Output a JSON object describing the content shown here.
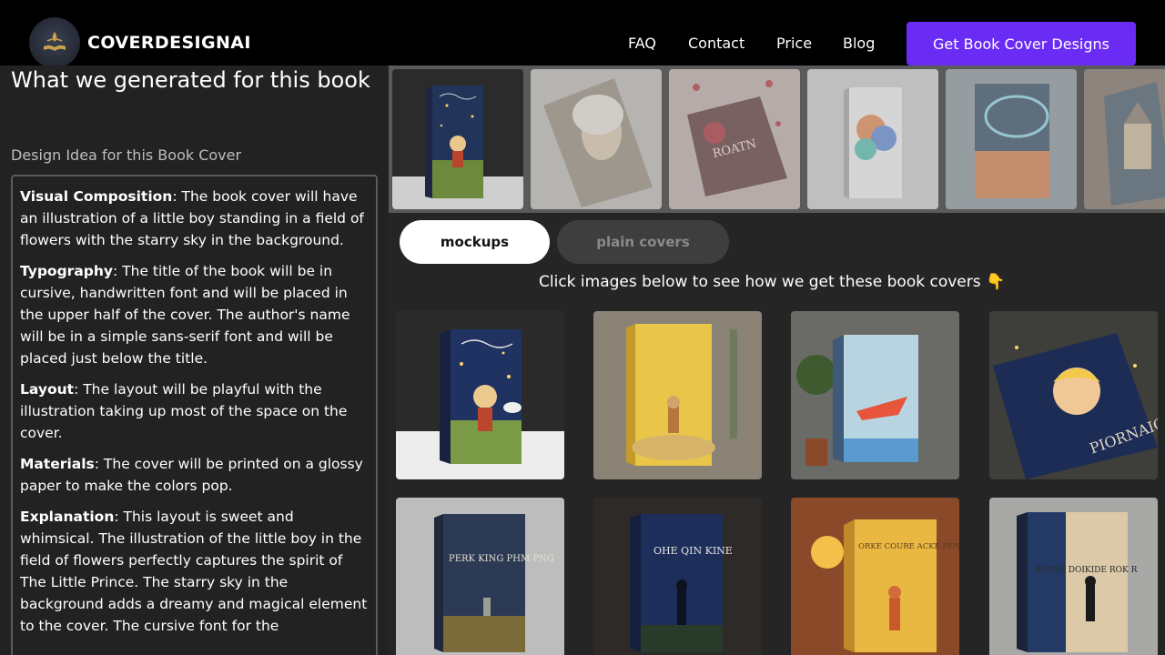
{
  "header": {
    "brand": "COVERDESIGNAI",
    "nav": [
      "FAQ",
      "Contact",
      "Price",
      "Blog"
    ],
    "cta_label": "Get Book Cover Designs"
  },
  "left": {
    "title": "What we generated for this book",
    "subtitle": "Design Idea for this Book Cover",
    "sections": [
      {
        "label": "Visual Composition",
        "text": ": The book cover will have an illustration of a little boy standing in a field of flowers with the starry sky in the background."
      },
      {
        "label": "Typography",
        "text": ": The title of the book will be in cursive, handwritten font and will be placed in the upper half of the cover. The author's name will be in a simple sans-serif font and will be placed just below the title."
      },
      {
        "label": "Layout",
        "text": ": The layout will be playful with the illustration taking up most of the space on the cover."
      },
      {
        "label": "Materials",
        "text": ": The cover will be printed on a glossy paper to make the colors pop."
      },
      {
        "label": "Explanation",
        "text": ": This layout is sweet and whimsical. The illustration of the little boy in the field of flowers perfectly captures the spirit of The Little Prince. The starry sky in the background adds a dreamy and magical element to the cover. The cursive font for the"
      }
    ]
  },
  "strip": {
    "thumbs": [
      {
        "name": "thumb-starry-boy",
        "active": true
      },
      {
        "name": "thumb-woman-portrait",
        "active": false
      },
      {
        "name": "thumb-roses-roatn",
        "text": "ROATN",
        "active": false
      },
      {
        "name": "thumb-watercolor",
        "active": false
      },
      {
        "name": "thumb-space-sunset",
        "active": false
      },
      {
        "name": "thumb-castle",
        "active": false
      }
    ]
  },
  "tabs": {
    "mockups": "mockups",
    "plain": "plain covers"
  },
  "hint": "Click images below to see how we get these book covers 👇",
  "grid": [
    {
      "name": "card-starry-boy"
    },
    {
      "name": "card-yellow-hiker"
    },
    {
      "name": "card-airplane"
    },
    {
      "name": "card-blond-boy",
      "text": "PIORNAICE"
    },
    {
      "name": "card-field-boy",
      "text": "PERK KING PHM PNG"
    },
    {
      "name": "card-night-silhouette",
      "text": "OHE QIN KINE"
    },
    {
      "name": "card-sunset-prince",
      "text": "ORKE COURE ACKE PENCE"
    },
    {
      "name": "card-map-silhouette",
      "text": "RGOLE DOIKIDE ROK R"
    }
  ],
  "colors": {
    "accent": "#6a2cf5",
    "background": "#222222",
    "header": "#000000"
  }
}
